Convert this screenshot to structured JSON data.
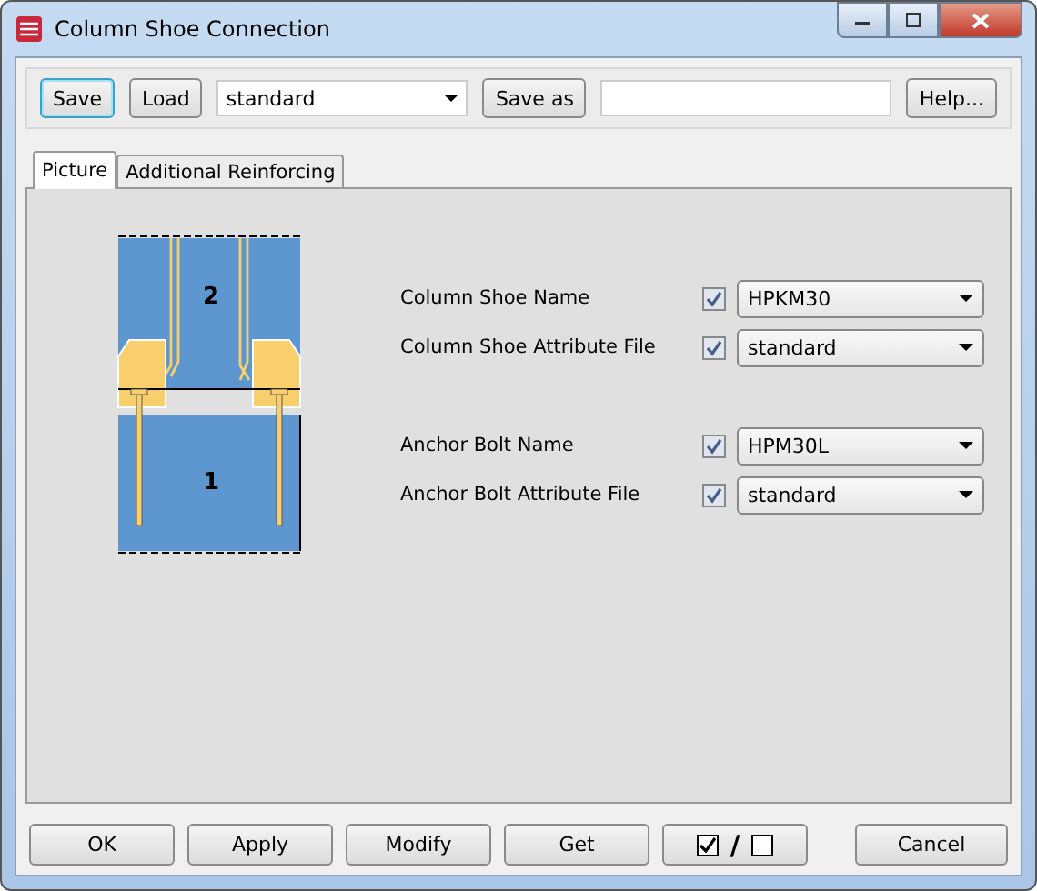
{
  "window": {
    "title": "Column Shoe Connection"
  },
  "toolbar": {
    "save": "Save",
    "load": "Load",
    "preset": "standard",
    "save_as": "Save as",
    "help": "Help..."
  },
  "tabs": [
    {
      "label": "Picture",
      "selected": true
    },
    {
      "label": "Additional Reinforcing",
      "selected": false
    }
  ],
  "drawing": {
    "upper_label": "2",
    "lower_label": "1"
  },
  "field_groups": [
    {
      "fields": [
        {
          "label": "Column Shoe Name",
          "checked": true,
          "value": "HPKM30"
        },
        {
          "label": "Column Shoe Attribute File",
          "checked": true,
          "value": "standard"
        }
      ]
    },
    {
      "fields": [
        {
          "label": "Anchor Bolt Name",
          "checked": true,
          "value": "HPM30L"
        },
        {
          "label": "Anchor Bolt Attribute File",
          "checked": true,
          "value": "standard"
        }
      ]
    }
  ],
  "buttons": {
    "ok": "OK",
    "apply": "Apply",
    "modify": "Modify",
    "get": "Get",
    "toggle_separator": "/",
    "cancel": "Cancel"
  }
}
